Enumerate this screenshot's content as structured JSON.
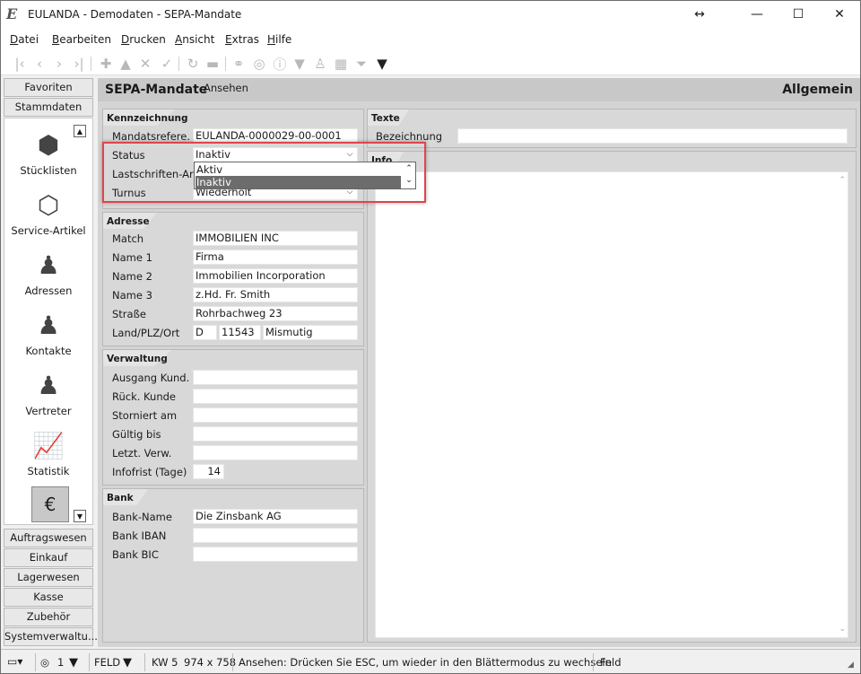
{
  "window": {
    "title": "EULANDA - Demodaten - SEPA-Mandate",
    "app_logo": "E"
  },
  "menu": [
    {
      "label": "Datei",
      "ul": "D",
      "rest": "atei"
    },
    {
      "label": "Bearbeiten",
      "ul": "B",
      "rest": "earbeiten"
    },
    {
      "label": "Drucken",
      "ul": "D",
      "rest": "rucken"
    },
    {
      "label": "Ansicht",
      "ul": "A",
      "rest": "nsicht"
    },
    {
      "label": "Extras",
      "ul": "E",
      "rest": "xtras"
    },
    {
      "label": "Hilfe",
      "ul": "H",
      "rest": "ilfe"
    }
  ],
  "toolbar_icons": [
    "first-icon",
    "prev-icon",
    "next-icon",
    "last-icon",
    "add-icon",
    "up-icon",
    "delete-icon",
    "confirm-icon",
    "refresh-icon",
    "minus-icon",
    "binoculars-icon",
    "target-icon",
    "info-icon",
    "funnel-down-icon",
    "person-icon",
    "grid-icon",
    "filter-icon",
    "dropdown-icon"
  ],
  "nav": {
    "top_buttons": [
      "Favoriten",
      "Stammdaten"
    ],
    "items": [
      {
        "label": "Stücklisten",
        "icon": "cubes-icon"
      },
      {
        "label": "Service-Artikel",
        "icon": "cube-icon"
      },
      {
        "label": "Adressen",
        "icon": "person-icon"
      },
      {
        "label": "Kontakte",
        "icon": "person-icon"
      },
      {
        "label": "Vertreter",
        "icon": "person-icon"
      },
      {
        "label": "Statistik",
        "icon": "chart-icon"
      }
    ],
    "bottom_buttons": [
      "Auftragswesen",
      "Einkauf",
      "Lagerwesen",
      "Kasse",
      "Zubehör",
      "Systemverwaltu..."
    ]
  },
  "header": {
    "title": "SEPA-Mandate",
    "mode": "Ansehen",
    "tab": "Allgemein"
  },
  "kennzeichnung": {
    "title": "Kennzeichnung",
    "mandat_label": "Mandatsrefere.",
    "mandat_value": "EULANDA-0000029-00-0001",
    "status_label": "Status",
    "status_value": "Inaktiv",
    "lastschrift_label": "Lastschriften-Art",
    "turnus_label": "Turnus",
    "turnus_value": "Wiederholt",
    "status_options": [
      "Aktiv",
      "Inaktiv"
    ]
  },
  "texte": {
    "title": "Texte",
    "bezeichnung_label": "Bezeichnung",
    "bezeichnung_value": "",
    "info_title": "Info"
  },
  "adresse": {
    "title": "Adresse",
    "fields": [
      {
        "label": "Match",
        "value": "IMMOBILIEN INC"
      },
      {
        "label": "Name 1",
        "value": "Firma"
      },
      {
        "label": "Name 2",
        "value": "Immobilien Incorporation"
      },
      {
        "label": "Name 3",
        "value": "z.Hd. Fr. Smith"
      },
      {
        "label": "Straße",
        "value": "Rohrbachweg 23"
      }
    ],
    "land_label": "Land/PLZ/Ort",
    "land": "D",
    "plz": "11543",
    "ort": "Mismutig"
  },
  "verwaltung": {
    "title": "Verwaltung",
    "fields": [
      {
        "label": "Ausgang Kund.",
        "value": ""
      },
      {
        "label": "Rück. Kunde",
        "value": ""
      },
      {
        "label": "Storniert am",
        "value": ""
      },
      {
        "label": "Gültig bis",
        "value": ""
      },
      {
        "label": "Letzt. Verw.",
        "value": ""
      }
    ],
    "infofrist_label": "Infofrist (Tage)",
    "infofrist_value": "14"
  },
  "bank": {
    "title": "Bank",
    "fields": [
      {
        "label": "Bank-Name",
        "value": "Die Zinsbank AG"
      },
      {
        "label": "Bank IBAN",
        "value": ""
      },
      {
        "label": "Bank BIC",
        "value": ""
      }
    ]
  },
  "statusbar": {
    "count": "1",
    "feld": "FELD",
    "kw": "KW 5",
    "size": "974 x 758",
    "message": "Ansehen: Drücken Sie ESC, um wieder in den Blättermodus zu wechseln",
    "field": "Feld"
  }
}
